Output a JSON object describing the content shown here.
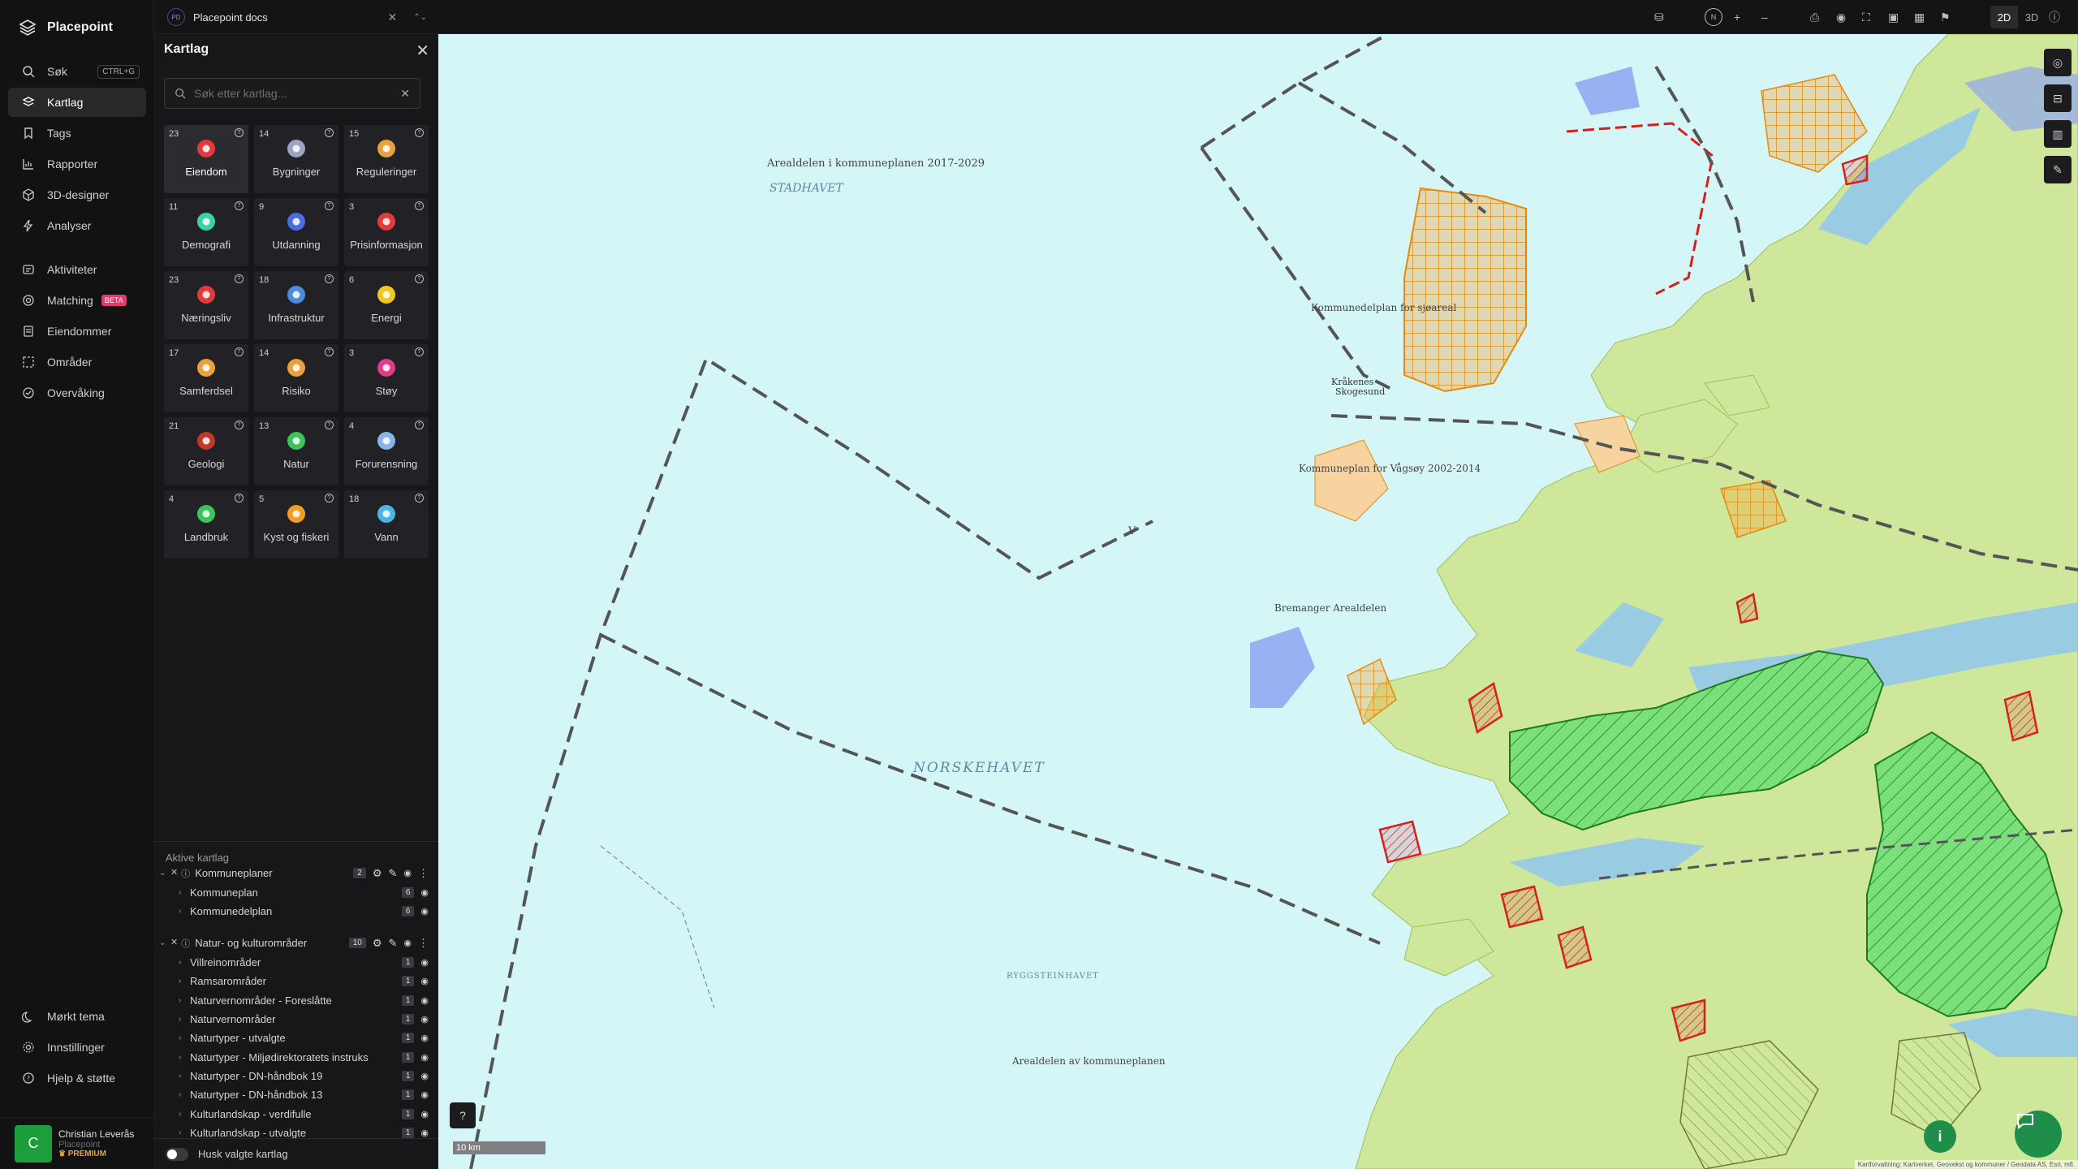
{
  "app": {
    "name": "Placepoint"
  },
  "nav": {
    "items": [
      {
        "label": "Søk",
        "icon": "search-icon",
        "shortcut": "CTRL+G"
      },
      {
        "label": "Kartlag",
        "icon": "layers-icon",
        "active": true
      },
      {
        "label": "Tags",
        "icon": "bookmark-icon"
      },
      {
        "label": "Rapporter",
        "icon": "bar-chart-icon"
      },
      {
        "label": "3D-designer",
        "icon": "cube-icon"
      },
      {
        "label": "Analyser",
        "icon": "bolt-icon"
      },
      {
        "label": "Aktiviteter",
        "icon": "stack-icon"
      },
      {
        "label": "Matching",
        "icon": "target-icon",
        "badge": "BETA"
      },
      {
        "label": "Eiendommer",
        "icon": "document-icon"
      },
      {
        "label": "Områder",
        "icon": "area-icon"
      },
      {
        "label": "Overvåking",
        "icon": "monitor-icon"
      }
    ],
    "bottom": [
      {
        "label": "Mørkt tema",
        "icon": "moon-icon"
      },
      {
        "label": "Innstillinger",
        "icon": "gear-icon"
      },
      {
        "label": "Hjelp & støtte",
        "icon": "help-icon"
      }
    ],
    "user": {
      "initial": "C",
      "name": "Christian Leverås",
      "org": "Placepoint",
      "plan": "PREMIUM"
    }
  },
  "topbar": {
    "doc_badge": "PD",
    "doc_name": "Placepoint docs",
    "compass": "N",
    "view_2d": "2D",
    "view_3d": "3D"
  },
  "panel": {
    "title": "Kartlag",
    "search_placeholder": "Søk etter kartlag...",
    "tiles": [
      {
        "count": "23",
        "label": "Eiendom",
        "icon": "pin-icon",
        "color": "#e23b3b",
        "selected": true
      },
      {
        "count": "14",
        "label": "Bygninger",
        "icon": "building-icon",
        "color": "#9aa4c4"
      },
      {
        "count": "15",
        "label": "Reguleringer",
        "icon": "signpost-icon",
        "color": "#e9a23b"
      },
      {
        "count": "11",
        "label": "Demografi",
        "icon": "people-icon",
        "color": "#3bd3a0"
      },
      {
        "count": "9",
        "label": "Utdanning",
        "icon": "graduation-icon",
        "color": "#4b6be0"
      },
      {
        "count": "3",
        "label": "Prisinformasjon",
        "icon": "bag-icon",
        "color": "#e23b3b"
      },
      {
        "count": "23",
        "label": "Næringsliv",
        "icon": "shop-icon",
        "color": "#e23b3b"
      },
      {
        "count": "18",
        "label": "Infrastruktur",
        "icon": "globe-icon",
        "color": "#4b8be0"
      },
      {
        "count": "6",
        "label": "Energi",
        "icon": "lightning-icon",
        "color": "#f3c623"
      },
      {
        "count": "17",
        "label": "Samferdsel",
        "icon": "bus-icon",
        "color": "#e9a23b"
      },
      {
        "count": "14",
        "label": "Risiko",
        "icon": "hazard-icon",
        "color": "#e9a23b"
      },
      {
        "count": "3",
        "label": "Støy",
        "icon": "noise-icon",
        "color": "#e23b8a"
      },
      {
        "count": "21",
        "label": "Geologi",
        "icon": "terrain-icon",
        "color": "#c0392b"
      },
      {
        "count": "13",
        "label": "Natur",
        "icon": "leaf-icon",
        "color": "#3bc45a"
      },
      {
        "count": "4",
        "label": "Forurensning",
        "icon": "factory-icon",
        "color": "#8ab4e6"
      },
      {
        "count": "4",
        "label": "Landbruk",
        "icon": "sprout-icon",
        "color": "#3bc45a"
      },
      {
        "count": "5",
        "label": "Kyst og fiskeri",
        "icon": "fish-icon",
        "color": "#f39c23"
      },
      {
        "count": "18",
        "label": "Vann",
        "icon": "water-drop-icon",
        "color": "#4bb3e6"
      }
    ],
    "active_title": "Aktive kartlag",
    "groups": [
      {
        "name": "Kommuneplaner",
        "count": "2",
        "layers": [
          {
            "name": "Kommuneplan",
            "count": "6"
          },
          {
            "name": "Kommunedelplan",
            "count": "6"
          }
        ]
      },
      {
        "name": "Natur- og kulturområder",
        "count": "10",
        "layers": [
          {
            "name": "Villreinområder",
            "count": "1"
          },
          {
            "name": "Ramsarområder",
            "count": "1"
          },
          {
            "name": "Naturvernområder - Foreslåtte",
            "count": "1"
          },
          {
            "name": "Naturvernområder",
            "count": "1"
          },
          {
            "name": "Naturtyper - utvalgte",
            "count": "1"
          },
          {
            "name": "Naturtyper - Miljødirektoratets instruks",
            "count": "1"
          },
          {
            "name": "Naturtyper - DN-håndbok 19",
            "count": "1"
          },
          {
            "name": "Naturtyper - DN-håndbok 13",
            "count": "1"
          },
          {
            "name": "Kulturlandskap - verdifulle",
            "count": "1"
          },
          {
            "name": "Kulturlandskap - utvalgte",
            "count": "1"
          }
        ]
      }
    ],
    "remember_label": "Husk valgte kartlag"
  },
  "map": {
    "labels": {
      "stadhavet": "STADHAVET",
      "norskehavet": "NORSKEHAVET",
      "ryggsteinhavet": "RYGGSTEINHAVET",
      "arealdelen": "Arealdelen i kommuneplanen 2017-2029",
      "kommunedelplan": "Kommunedelplan for sjøareal",
      "kommuneplan": "Kommuneplan for Vågsøy 2002-2014",
      "bremanger": "Bremanger Arealdelen",
      "arealdelen2": "Arealdelen av kommuneplanen",
      "v_label": "V",
      "skoger": "Skogesund",
      "kraakenes": "Kråkenes"
    },
    "scale": "10 km",
    "attribution": "Kartforvaltning: Kartverket, Geovekst og kommuner / Geodata AS, Esri, mfl.",
    "colors": {
      "sea": "#d4f6f7",
      "land": "#cfe79a",
      "deep_water": "#8fc6ee",
      "protected": "#6fd66f",
      "plan": "#f2a33a",
      "restricted": "#d81e1e"
    }
  }
}
